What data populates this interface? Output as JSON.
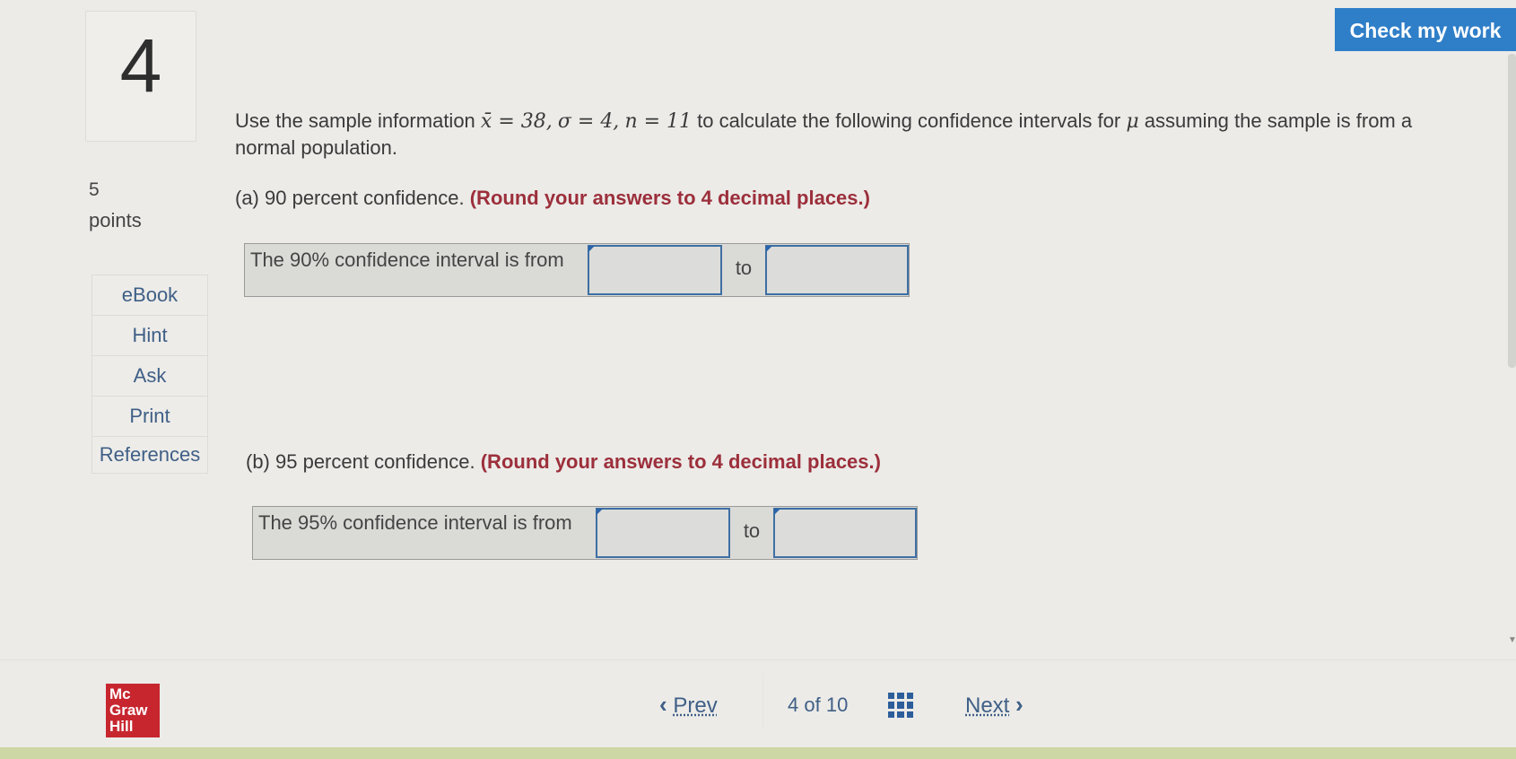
{
  "question": {
    "number": "4",
    "points_value": "5",
    "points_label": "points"
  },
  "sidebar": {
    "tools": [
      "eBook",
      "Hint",
      "Ask",
      "Print",
      "References"
    ]
  },
  "header": {
    "check_button": "Check my work"
  },
  "problem": {
    "intro": "Use the sample information",
    "given_xbar": "x̄ = 38,",
    "given_sigma": "σ = 4,",
    "given_n": "n = 11",
    "rest_a": "to calculate the following confidence intervals for",
    "mu": "μ",
    "rest_b": "assuming the sample is from a normal population."
  },
  "part_a": {
    "label": "(a) 90 percent confidence.",
    "instruction": "(Round your answers to 4 decimal places.)",
    "row_label": "The 90% confidence interval is from",
    "to_text": "to",
    "lower_value": "",
    "upper_value": ""
  },
  "part_b": {
    "label": "(b) 95 percent confidence.",
    "instruction": "(Round your answers to 4 decimal places.)",
    "row_label": "The 95% confidence interval is from",
    "to_text": "to",
    "lower_value": "",
    "upper_value": ""
  },
  "footer": {
    "logo_lines": [
      "Mc",
      "Graw",
      "Hill"
    ],
    "prev_label": "Prev",
    "page_current": "4",
    "page_of": "of",
    "page_total": "10",
    "next_label": "Next",
    "grid_icon": "grid-icon"
  },
  "colors": {
    "accent_blue": "#2f7ec8",
    "instruction_red": "#9c2f3b",
    "link_blue": "#3f5f86",
    "logo_red": "#c7262f"
  }
}
